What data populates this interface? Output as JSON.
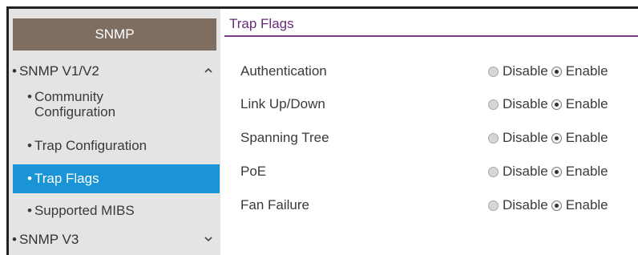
{
  "sidebar": {
    "header": "SNMP",
    "groups": [
      {
        "label": "SNMP V1/V2",
        "expanded": true,
        "icon": "chevron-up-icon"
      },
      {
        "label": "SNMP V3",
        "expanded": false,
        "icon": "chevron-down-icon"
      }
    ],
    "items": [
      {
        "line1": "Community",
        "line2": "Configuration"
      },
      {
        "label": "Trap Configuration"
      },
      {
        "label": "Trap Flags",
        "active": true
      },
      {
        "label": "Supported MIBS"
      }
    ],
    "bullet": "•"
  },
  "main": {
    "tab": "Trap Flags",
    "disable_label": "Disable",
    "enable_label": "Enable",
    "rows": [
      {
        "label": "Authentication",
        "value": "Enable"
      },
      {
        "label": "Link Up/Down",
        "value": "Enable"
      },
      {
        "label": "Spanning Tree",
        "value": "Enable"
      },
      {
        "label": "PoE",
        "value": "Enable"
      },
      {
        "label": "Fan Failure",
        "value": "Enable"
      }
    ]
  },
  "colors": {
    "sidebar_header_bg": "#7d6e61",
    "active_item_bg": "#1a94d7",
    "tab_accent": "#7b3c8e"
  }
}
